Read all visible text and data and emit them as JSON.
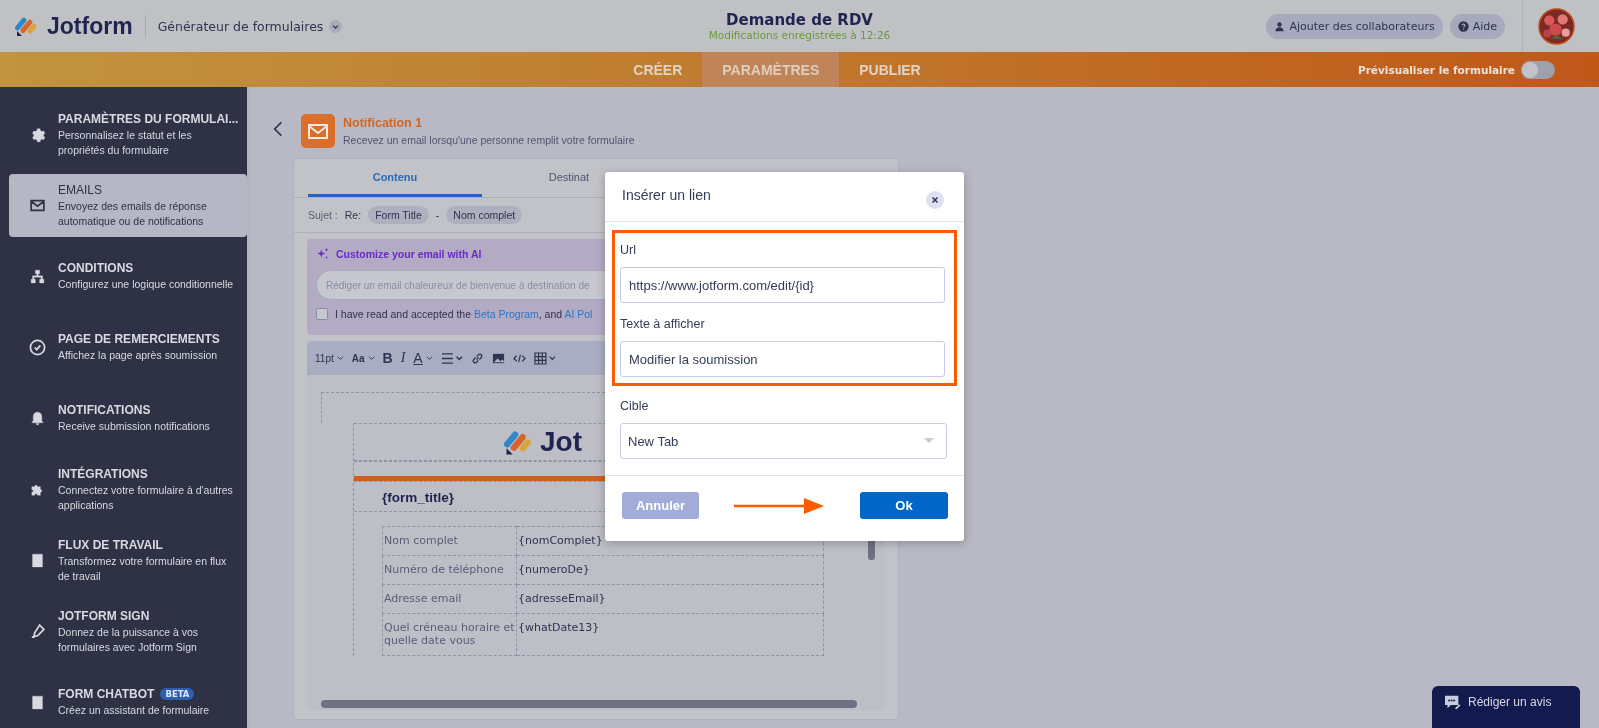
{
  "header": {
    "brand": "Jotform",
    "builder": "Générateur de formulaires",
    "form_title": "Demande de RDV",
    "save_status": "Modifications enregistrées à 12:26",
    "collaborators_button": "Ajouter des collaborateurs",
    "help_button": "Aide"
  },
  "nav": {
    "tabs": [
      {
        "label": "CRÉER",
        "selected": false
      },
      {
        "label": "PARAMÈTRES",
        "selected": true
      },
      {
        "label": "PUBLIER",
        "selected": false
      }
    ],
    "preview": {
      "label": "Prévisualiser le formulaire",
      "on": false
    }
  },
  "sidebar": {
    "items": [
      {
        "title": "PARAMÈTRES DU FORMULAI...",
        "description": "Personnalisez le statut et les propriétés du formulaire",
        "selected": false
      },
      {
        "title": "EMAILS",
        "description": "Envoyez des emails de réponse automatique ou de notifications",
        "selected": true
      },
      {
        "title": "CONDITIONS",
        "description": "Configurez une logique conditionnelle",
        "selected": false
      },
      {
        "title": "PAGE DE REMERCIEMENTS",
        "description": "Affichez la page après soumission",
        "selected": false
      },
      {
        "title": "NOTIFICATIONS",
        "description": "Receive submission notifications",
        "selected": false
      },
      {
        "title": "INTÉGRATIONS",
        "description": "Connectez votre formulaire à d'autres applications",
        "selected": false
      },
      {
        "title": "FLUX DE TRAVAIL",
        "description": "Transformez votre formulaire en flux de travail",
        "selected": false
      },
      {
        "title": "JOTFORM SIGN",
        "description": "Donnez de la puissance à vos formulaires avec Jotform Sign",
        "selected": false
      },
      {
        "title": "FORM CHATBOT",
        "badge": "BETA",
        "description": "Créez un assistant de formulaire",
        "selected": false
      }
    ]
  },
  "notification": {
    "title": "Notification 1",
    "subtitle": "Recevez un email lorsqu'une personne remplit votre formulaire"
  },
  "editor": {
    "tabs": [
      {
        "label": "Contenu",
        "selected": true
      },
      {
        "label": "Destinat",
        "selected": false
      }
    ],
    "subject": {
      "label": "Sujet :",
      "prefix": "Re:",
      "tags": [
        "Form Title",
        "Nom complet"
      ],
      "separator": "-"
    },
    "ai": {
      "title": "Customize your email with AI",
      "placeholder": "Rédiger un email chaleureux de bienvenue à destination de",
      "consent": {
        "checked": false,
        "before": "I have read and accepted the ",
        "link": "Beta Program",
        "middle": ", and ",
        "link_2": "AI Pol"
      }
    },
    "toolbar": {
      "font_size": "11pt",
      "text_case": "Aa",
      "bold": "B",
      "italic": "I",
      "foreground": "A"
    },
    "body": {
      "brand": "Jot",
      "form_title": "{form_title}",
      "rows": [
        {
          "label": "Nom complet",
          "value": "{nomComplet}"
        },
        {
          "label": "Numéro de téléphone",
          "value": "{numeroDe}"
        },
        {
          "label": "Adresse email",
          "value": "{adresseEmail}"
        },
        {
          "label": "Quel créneau horaire et quelle date vous",
          "value": "{whatDate13}"
        }
      ]
    }
  },
  "dialog": {
    "title": "Insérer un lien",
    "fields": [
      {
        "label": "Url",
        "value": "https://www.jotform.com/edit/{id}"
      },
      {
        "label": "Texte à afficher",
        "value": "Modifier la soumission"
      }
    ],
    "target": {
      "label": "Cible",
      "value": "New Tab"
    },
    "cancel": {
      "label": "Annuler",
      "disabled": true
    },
    "ok": {
      "label": "Ok",
      "disabled": false
    }
  },
  "feedback_button": "Rédiger un avis"
}
